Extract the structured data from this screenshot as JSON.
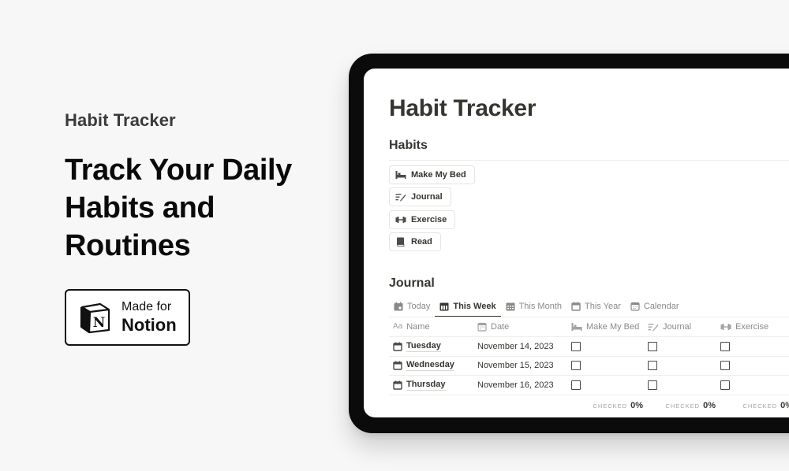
{
  "promo": {
    "subtitle": "Habit Tracker",
    "headline": "Track Your Daily Habits and Routines",
    "badge": {
      "line1": "Made for",
      "line2": "Notion",
      "logo_icon": "notion-logo-icon"
    }
  },
  "page": {
    "title": "Habit Tracker",
    "habits_heading": "Habits",
    "habit_buttons": [
      {
        "label": "Make My Bed",
        "icon": "bed-icon"
      },
      {
        "label": "Journal",
        "icon": "pen-list-icon"
      },
      {
        "label": "Exercise",
        "icon": "dumbbell-icon"
      },
      {
        "label": "Read",
        "icon": "book-icon"
      }
    ],
    "journal_heading": "Journal",
    "tabs": [
      {
        "label": "Today",
        "icon": "calendar-day-icon",
        "active": false
      },
      {
        "label": "This Week",
        "icon": "calendar-week-icon",
        "active": true
      },
      {
        "label": "This Month",
        "icon": "calendar-grid-icon",
        "active": false
      },
      {
        "label": "This Year",
        "icon": "calendar-icon",
        "active": false
      },
      {
        "label": "Calendar",
        "icon": "calendar-view-icon",
        "active": false
      }
    ],
    "table": {
      "columns": [
        {
          "label": "Name",
          "icon": "text-aa-icon"
        },
        {
          "label": "Date",
          "icon": "calendar-view-icon"
        },
        {
          "label": "Make My Bed",
          "icon": "bed-icon"
        },
        {
          "label": "Journal",
          "icon": "pen-list-icon"
        },
        {
          "label": "Exercise",
          "icon": "dumbbell-icon"
        }
      ],
      "rows": [
        {
          "name": "Tuesday",
          "date": "November 14, 2023",
          "make_my_bed": false,
          "journal": false,
          "exercise": false
        },
        {
          "name": "Wednesday",
          "date": "November 15, 2023",
          "make_my_bed": false,
          "journal": false,
          "exercise": false
        },
        {
          "name": "Thursday",
          "date": "November 16, 2023",
          "make_my_bed": false,
          "journal": false,
          "exercise": false
        }
      ],
      "footer": {
        "make_my_bed": {
          "label": "CHECKED",
          "value": "0%"
        },
        "journal": {
          "label": "CHECKED",
          "value": "0%"
        },
        "exercise": {
          "label": "CHECKED",
          "value": "0%"
        }
      }
    }
  }
}
